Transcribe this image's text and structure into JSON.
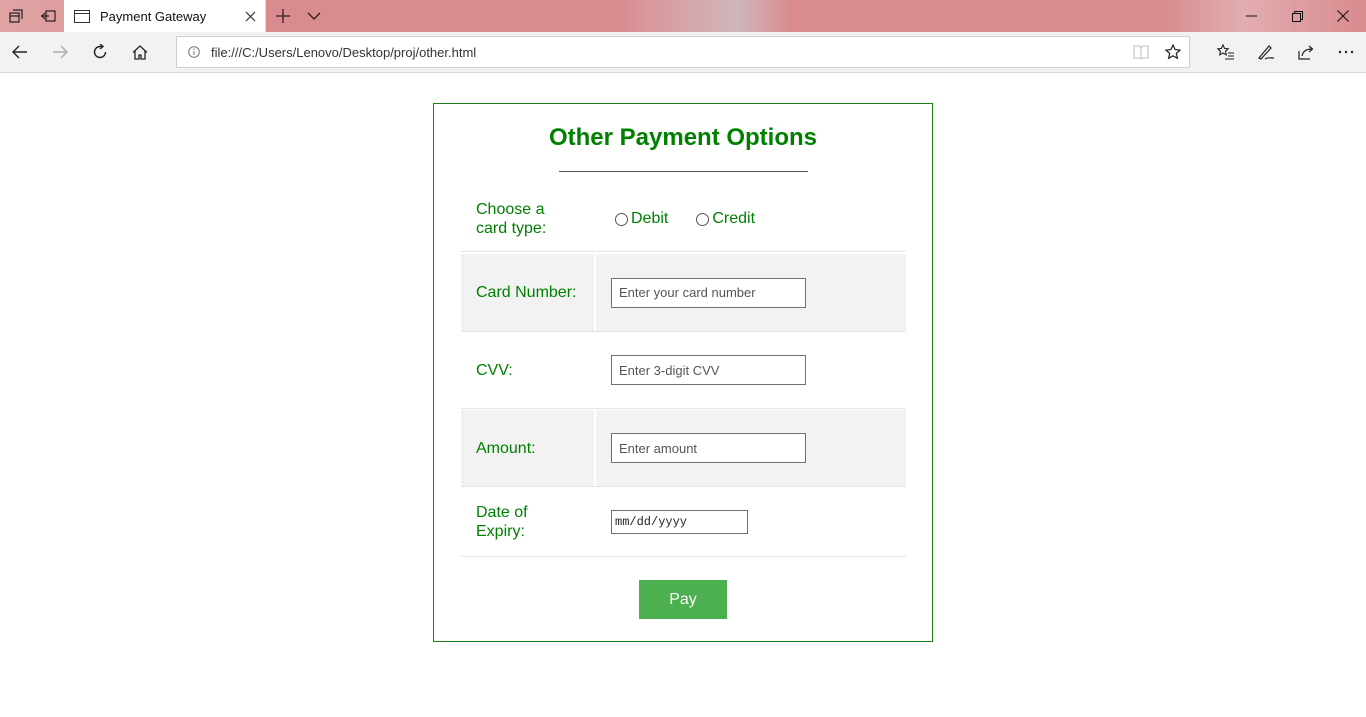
{
  "browser": {
    "tab": {
      "title": "Payment Gateway"
    },
    "address": {
      "url": "file:///C:/Users/Lenovo/Desktop/proj/other.html"
    },
    "icons": {
      "tab_actions": "tab-actions-icon",
      "set_aside": "set-aside-tabs-icon",
      "new_tab": "+",
      "tab_list": "chevron-down-icon",
      "minimize": "minimize-icon",
      "restore": "restore-icon",
      "close": "close-icon"
    }
  },
  "page": {
    "heading": "Other Payment Options",
    "card_type": {
      "label_line1": "Choose a",
      "label_line2": "card type:",
      "options": [
        "Debit",
        "Credit"
      ]
    },
    "card_number": {
      "label": "Card Number:",
      "placeholder": "Enter your card number"
    },
    "cvv": {
      "label": "CVV:",
      "placeholder": "Enter 3-digit CVV"
    },
    "amount": {
      "label": "Amount:",
      "placeholder": "Enter amount"
    },
    "expiry": {
      "label_line1": "Date of",
      "label_line2": "Expiry:",
      "placeholder": "mm/dd/yyyy"
    },
    "pay_label": "Pay"
  },
  "colors": {
    "accent_green": "#008000",
    "button_green": "#4caf50",
    "row_shade": "#f2f2f2"
  }
}
